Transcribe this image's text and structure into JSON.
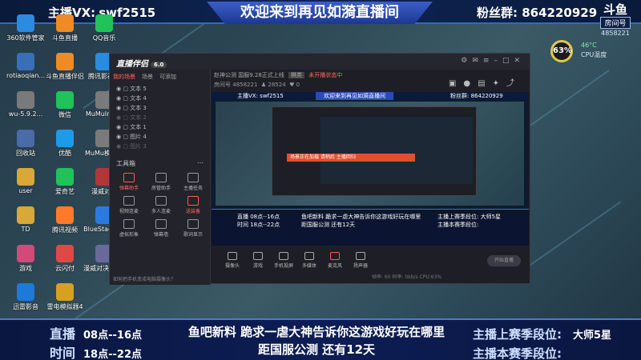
{
  "top_banner": {
    "left_label": "主播VX:",
    "left_value": "swf2515",
    "center_title": "欢迎来到再见如漪直播间",
    "right_label": "粉丝群:",
    "right_value": "864220929"
  },
  "logo": {
    "main": "斗鱼",
    "sub": "房间号",
    "room": "4858221"
  },
  "cpu_widget": {
    "percent": "63",
    "temp": "46°C",
    "label": "CPU温度"
  },
  "desktop_icons": [
    {
      "label": "360软件管家",
      "icon": "app-icon"
    },
    {
      "label": "斗鱼直播",
      "icon": "douyu-icon"
    },
    {
      "label": "QQ音乐",
      "icon": "music-icon"
    },
    {
      "label": "rotiaoqian...",
      "icon": "app-icon"
    },
    {
      "label": "斗鱼直播伴侣",
      "icon": "douyu-icon"
    },
    {
      "label": "腾讯影视库",
      "icon": "app-icon"
    },
    {
      "label": "wu-5.9.2...",
      "icon": "app-icon"
    },
    {
      "label": "微信",
      "icon": "wechat-icon"
    },
    {
      "label": "MuMuInst...",
      "icon": "app-icon"
    },
    {
      "label": "回收站",
      "icon": "recycle-icon"
    },
    {
      "label": "优酷",
      "icon": "app-icon"
    },
    {
      "label": "MuMu模拟器",
      "icon": "app-icon"
    },
    {
      "label": "user",
      "icon": "folder-icon"
    },
    {
      "label": "爱奇艺",
      "icon": "iqiyi-icon"
    },
    {
      "label": "漫威对决",
      "icon": "game-icon"
    },
    {
      "label": "TD",
      "icon": "folder-icon"
    },
    {
      "label": "腾讯视频",
      "icon": "video-icon"
    },
    {
      "label": "BlueStacks...",
      "icon": "app-icon"
    },
    {
      "label": "游戏",
      "icon": "game-icon"
    },
    {
      "label": "云闪付",
      "icon": "pay-icon"
    },
    {
      "label": "漫威对决模拟器",
      "icon": "game-icon"
    },
    {
      "label": "迅雷影音",
      "icon": "player-icon"
    },
    {
      "label": "雷电模拟器4",
      "icon": "app-icon"
    }
  ],
  "app": {
    "brand": "直播伴侣",
    "brand_tag": "6.0",
    "left_tabs": [
      "我的场景",
      "场景",
      "可添加"
    ],
    "layers": [
      {
        "label": "文本 5",
        "dim": false
      },
      {
        "label": "文本 4",
        "dim": false
      },
      {
        "label": "文本 3",
        "dim": false
      },
      {
        "label": "文本 2",
        "dim": true
      },
      {
        "label": "文本 1",
        "dim": false
      },
      {
        "label": "图片 4",
        "dim": false
      },
      {
        "label": "图片 3",
        "dim": true
      }
    ],
    "tools_heading": "工具箱",
    "tools": [
      {
        "label": "弹幕助手",
        "red": true
      },
      {
        "label": "房管助手",
        "red": false
      },
      {
        "label": "主播任务",
        "red": false
      },
      {
        "label": "视频连麦",
        "red": false
      },
      {
        "label": "多人连麦",
        "red": false
      },
      {
        "label": "送装备",
        "red": true
      },
      {
        "label": "虚拟形象",
        "red": false
      },
      {
        "label": "弹幕墙",
        "red": false
      },
      {
        "label": "歌词显示",
        "red": false
      }
    ],
    "footer_tip": "如何把手机变成电脑摄像头？",
    "stream_title": "赵神公测 国服9.28正式上线",
    "category": "棋类",
    "status_text": "未开播状态中",
    "room_label": "房间号",
    "room_id": "4858221",
    "fans": "28524",
    "likes": "0",
    "bottom_tools": [
      {
        "label": "摄像头",
        "red": false
      },
      {
        "label": "游戏",
        "red": false
      },
      {
        "label": "手机投屏",
        "red": false
      },
      {
        "label": "多媒体",
        "red": false
      },
      {
        "label": "麦克风",
        "red": true
      },
      {
        "label": "扬声器",
        "red": false
      }
    ],
    "start_label": "开始直播",
    "stats": "帧率: 60  码率: 0kb/s  CPU:63%"
  },
  "preview": {
    "mini_top_left": "主播VX: swf2515",
    "mini_top_center": "欢迎来到再见如漪直播间",
    "mini_top_right": "粉丝群: 864220929",
    "red_strip": "场景正在加载 请稍后 主播回归",
    "mini_bottom_left_1": "直播 08点--16点",
    "mini_bottom_left_2": "时间 18点--22点",
    "mini_bottom_mid_1": "鱼吧新料 跪求一虐大神告诉你这游戏好玩在哪里",
    "mini_bottom_mid_2": "距国服公测 还有12天",
    "mini_bottom_right_1": "主播上赛季段位: 大师5星",
    "mini_bottom_right_2": "主播本赛季段位:"
  },
  "bottom_banner": {
    "live_label": "直播",
    "live_hours": "08点--16点",
    "time_label": "时间",
    "time_hours": "18点--22点",
    "news_line": "鱼吧新料   跪求一虐大神告诉你这游戏好玩在哪里",
    "countdown": "距国服公测   还有12天",
    "last_season_label": "主播上赛季段位:",
    "last_season_value": "大师5星",
    "this_season_label": "主播本赛季段位:",
    "this_season_value": ""
  }
}
